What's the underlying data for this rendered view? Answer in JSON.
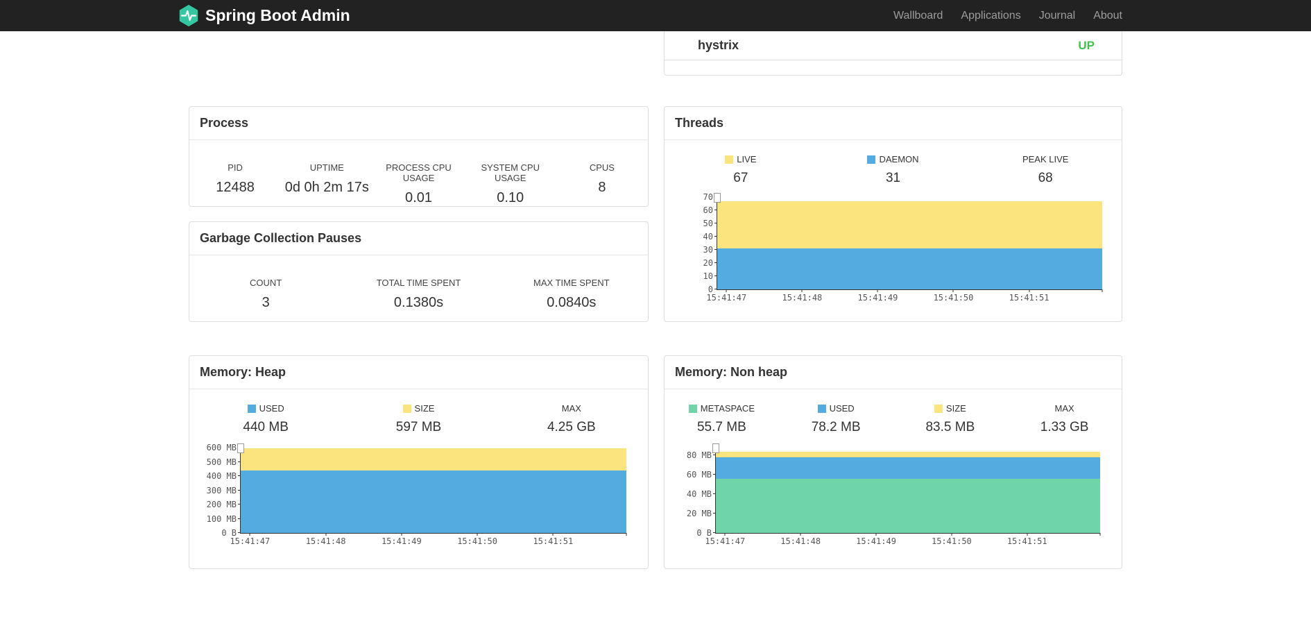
{
  "navbar": {
    "brand": "Spring Boot Admin",
    "items": [
      {
        "label": "Wallboard"
      },
      {
        "label": "Applications"
      },
      {
        "label": "Journal"
      },
      {
        "label": "About"
      }
    ]
  },
  "colors": {
    "navbar_bg": "#222222",
    "logo_teal": "#34c7a0",
    "yellow": "#fbe37d",
    "blue": "#54abe0",
    "green": "#6fd5a8",
    "status_up": "#43c04e"
  },
  "hystrix": {
    "name": "hystrix",
    "status": "UP",
    "status_color": "#43c04e"
  },
  "process": {
    "title": "Process",
    "metrics": [
      {
        "label": "PID",
        "value": "12488"
      },
      {
        "label": "UPTIME",
        "value": "0d 0h 2m 17s"
      },
      {
        "label": "PROCESS CPU USAGE",
        "value": "0.01"
      },
      {
        "label": "SYSTEM CPU USAGE",
        "value": "0.10"
      },
      {
        "label": "CPUS",
        "value": "8"
      }
    ]
  },
  "gc": {
    "title": "Garbage Collection Pauses",
    "metrics": [
      {
        "label": "COUNT",
        "value": "3"
      },
      {
        "label": "TOTAL TIME SPENT",
        "value": "0.1380s"
      },
      {
        "label": "MAX TIME SPENT",
        "value": "0.0840s"
      }
    ]
  },
  "threads": {
    "title": "Threads",
    "legend": [
      {
        "label": "LIVE",
        "value": "67",
        "color": "#fbe37d"
      },
      {
        "label": "DAEMON",
        "value": "31",
        "color": "#54abe0"
      },
      {
        "label": "PEAK LIVE",
        "value": "68",
        "color": null
      }
    ]
  },
  "heap": {
    "title": "Memory: Heap",
    "legend": [
      {
        "label": "USED",
        "value": "440 MB",
        "color": "#54abe0"
      },
      {
        "label": "SIZE",
        "value": "597 MB",
        "color": "#fbe37d"
      },
      {
        "label": "MAX",
        "value": "4.25 GB",
        "color": null
      }
    ]
  },
  "nonheap": {
    "title": "Memory: Non heap",
    "legend": [
      {
        "label": "METASPACE",
        "value": "55.7 MB",
        "color": "#6fd5a8"
      },
      {
        "label": "USED",
        "value": "78.2 MB",
        "color": "#54abe0"
      },
      {
        "label": "SIZE",
        "value": "83.5 MB",
        "color": "#fbe37d"
      },
      {
        "label": "MAX",
        "value": "1.33 GB",
        "color": null
      }
    ]
  },
  "chart_data": [
    {
      "type": "area",
      "title": "Threads",
      "ylim": [
        0,
        70
      ],
      "ymax": 70,
      "yticks": [
        {
          "v": 0,
          "label": "0"
        },
        {
          "v": 10,
          "label": "10"
        },
        {
          "v": 20,
          "label": "20"
        },
        {
          "v": 30,
          "label": "30"
        },
        {
          "v": 40,
          "label": "40"
        },
        {
          "v": 50,
          "label": "50"
        },
        {
          "v": 60,
          "label": "60"
        },
        {
          "v": 70,
          "label": "70"
        }
      ],
      "xticks": [
        "15:41:47",
        "15:41:48",
        "15:41:49",
        "15:41:50",
        "15:41:51"
      ],
      "series": [
        {
          "name": "DAEMON",
          "color": "#54abe0",
          "value": 31
        },
        {
          "name": "LIVE",
          "color": "#fbe37d",
          "value": 67
        }
      ],
      "legend_position": "top",
      "grid": false
    },
    {
      "type": "area",
      "title": "Memory: Heap",
      "ylabel_unit": "MB",
      "ylim": [
        0,
        600
      ],
      "ymax": 600,
      "yticks": [
        {
          "v": 0,
          "label": "0 B"
        },
        {
          "v": 100,
          "label": "100 MB"
        },
        {
          "v": 200,
          "label": "200 MB"
        },
        {
          "v": 300,
          "label": "300 MB"
        },
        {
          "v": 400,
          "label": "400 MB"
        },
        {
          "v": 500,
          "label": "500 MB"
        },
        {
          "v": 600,
          "label": "600 MB"
        }
      ],
      "xticks": [
        "15:41:47",
        "15:41:48",
        "15:41:49",
        "15:41:50",
        "15:41:51"
      ],
      "series": [
        {
          "name": "USED",
          "color": "#54abe0",
          "value": 440
        },
        {
          "name": "SIZE",
          "color": "#fbe37d",
          "value": 597
        }
      ],
      "legend_position": "top",
      "grid": false
    },
    {
      "type": "area",
      "title": "Memory: Non heap",
      "ylabel_unit": "MB",
      "ylim": [
        0,
        88
      ],
      "ymax": 88,
      "yticks": [
        {
          "v": 0,
          "label": "0 B"
        },
        {
          "v": 20,
          "label": "20 MB"
        },
        {
          "v": 40,
          "label": "40 MB"
        },
        {
          "v": 60,
          "label": "60 MB"
        },
        {
          "v": 80,
          "label": "80 MB"
        }
      ],
      "xticks": [
        "15:41:47",
        "15:41:48",
        "15:41:49",
        "15:41:50",
        "15:41:51"
      ],
      "series": [
        {
          "name": "METASPACE",
          "color": "#6fd5a8",
          "value": 55.7
        },
        {
          "name": "USED",
          "color": "#54abe0",
          "value": 78.2
        },
        {
          "name": "SIZE",
          "color": "#fbe37d",
          "value": 83.5
        }
      ],
      "legend_position": "top",
      "grid": false
    }
  ]
}
